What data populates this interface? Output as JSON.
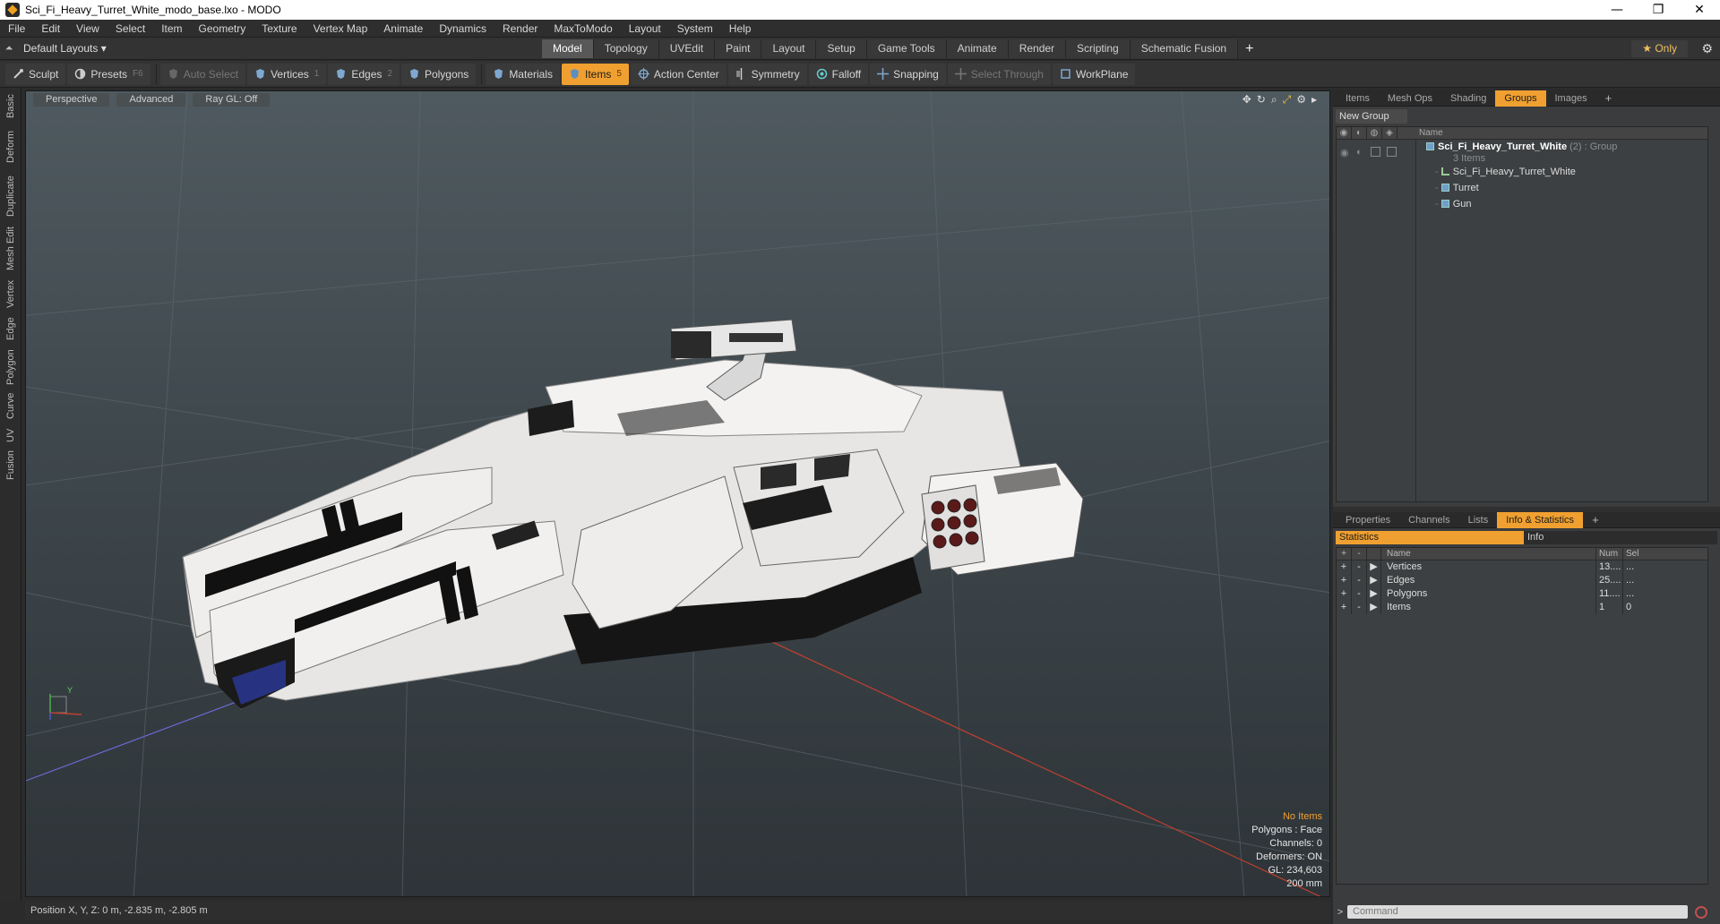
{
  "window": {
    "title": "Sci_Fi_Heavy_Turret_White_modo_base.lxo - MODO",
    "controls": [
      "—",
      "❐",
      "✕"
    ]
  },
  "menu": [
    "File",
    "Edit",
    "View",
    "Select",
    "Item",
    "Geometry",
    "Texture",
    "Vertex Map",
    "Animate",
    "Dynamics",
    "Render",
    "MaxToModo",
    "Layout",
    "System",
    "Help"
  ],
  "layout": {
    "name": "Default Layouts ▾",
    "tabs": [
      "Model",
      "Topology",
      "UVEdit",
      "Paint",
      "Layout",
      "Setup",
      "Game Tools",
      "Animate",
      "Render",
      "Scripting",
      "Schematic Fusion"
    ],
    "active_tab": "Model",
    "plus": "+",
    "only_label": "★ Only",
    "gear": "⚙"
  },
  "toolbar": {
    "sculpt": "Sculpt",
    "presets": "Presets",
    "presets_key": "F6",
    "auto_select": "Auto Select",
    "vertices": "Vertices",
    "vertices_key": "1",
    "edges": "Edges",
    "edges_key": "2",
    "polygons": "Polygons",
    "materials": "Materials",
    "items": "Items",
    "items_key": "5",
    "action_center": "Action Center",
    "symmetry": "Symmetry",
    "falloff": "Falloff",
    "snapping": "Snapping",
    "select_through": "Select Through",
    "workplane": "WorkPlane"
  },
  "left_tabs": [
    "Basic",
    "Deform",
    "Duplicate",
    "Mesh Edit",
    "Vertex",
    "Edge",
    "Polygon",
    "Curve",
    "UV",
    "Fusion"
  ],
  "viewport": {
    "view_mode": "Perspective",
    "shading": "Advanced",
    "raygl": "Ray GL: Off",
    "hud": {
      "no_items": "No Items",
      "polygons": "Polygons : Face",
      "channels": "Channels: 0",
      "deformers": "Deformers: ON",
      "gl": "GL: 234,603",
      "scale": "200 mm"
    },
    "axis_y": "Y"
  },
  "status": "Position X, Y, Z:   0 m, -2.835 m, -2.805 m",
  "groups_panel": {
    "tabs": [
      "Items",
      "Mesh Ops",
      "Shading",
      "Groups",
      "Images"
    ],
    "active_tab": "Groups",
    "new_group": "New Group",
    "name_header": "Name",
    "group_name": "Sci_Fi_Heavy_Turret_White",
    "group_suffix": " (2) : Group",
    "group_count": "3 Items",
    "children": [
      "Sci_Fi_Heavy_Turret_White",
      "Turret",
      "Gun"
    ]
  },
  "stats_panel": {
    "tabs": [
      "Properties",
      "Channels",
      "Lists",
      "Info & Statistics"
    ],
    "active_tab": "Info & Statistics",
    "subtabs": [
      "Statistics",
      "Info"
    ],
    "headers": [
      "+",
      "-",
      "",
      "Name",
      "Num",
      "Sel"
    ],
    "rows": [
      {
        "name": "Vertices",
        "num": "13....",
        "sel": "..."
      },
      {
        "name": "Edges",
        "num": "25....",
        "sel": "..."
      },
      {
        "name": "Polygons",
        "num": "11....",
        "sel": "..."
      },
      {
        "name": "Items",
        "num": "1",
        "sel": "0"
      }
    ]
  },
  "command": {
    "prompt": ">",
    "placeholder": "Command"
  },
  "colors": {
    "accent": "#f0a030",
    "viewport_top": "#4f5a60",
    "viewport_bottom": "#2e3438"
  }
}
